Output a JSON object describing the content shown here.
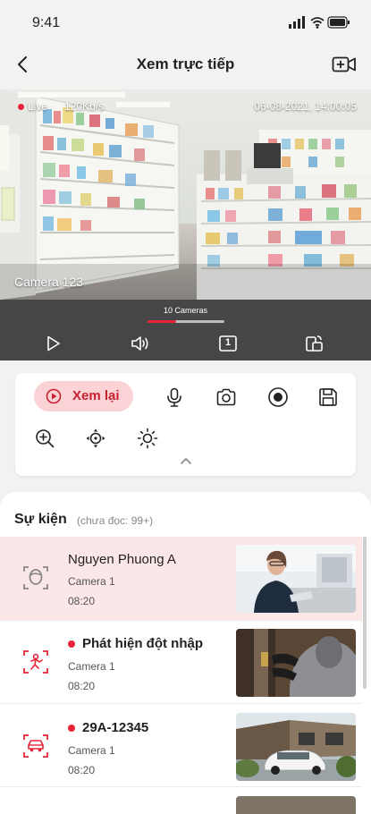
{
  "status_bar": {
    "time": "9:41"
  },
  "nav": {
    "title": "Xem trực tiếp"
  },
  "video": {
    "live_label": "Live",
    "bitrate": "120Kb/s",
    "datetime": "06-08-2021, 14:00:05",
    "camera_name": "Camera 123"
  },
  "controls": {
    "camera_count": "10 Cameras",
    "progress": 0.37,
    "layout_number": "1"
  },
  "actions": {
    "replay_label": "Xem lại"
  },
  "events": {
    "title": "Sự kiện",
    "unread": "(chưa đọc: 99+)",
    "items": [
      {
        "name": "Nguyen Phuong A",
        "camera": "Camera 1",
        "time": "08:20",
        "icon": "face-recognition-icon",
        "unread": false
      },
      {
        "name": "Phát hiện đột nhập",
        "camera": "Camera 1",
        "time": "08:20",
        "icon": "intrusion-icon",
        "unread": true
      },
      {
        "name": "29A-12345",
        "camera": "Camera 1",
        "time": "08:20",
        "icon": "car-icon",
        "unread": true
      }
    ]
  },
  "colors": {
    "accent": "#e8233a",
    "highlight_row": "#fbe6e8",
    "replay_bg": "#fbd3d7",
    "control_bar": "#464646"
  }
}
